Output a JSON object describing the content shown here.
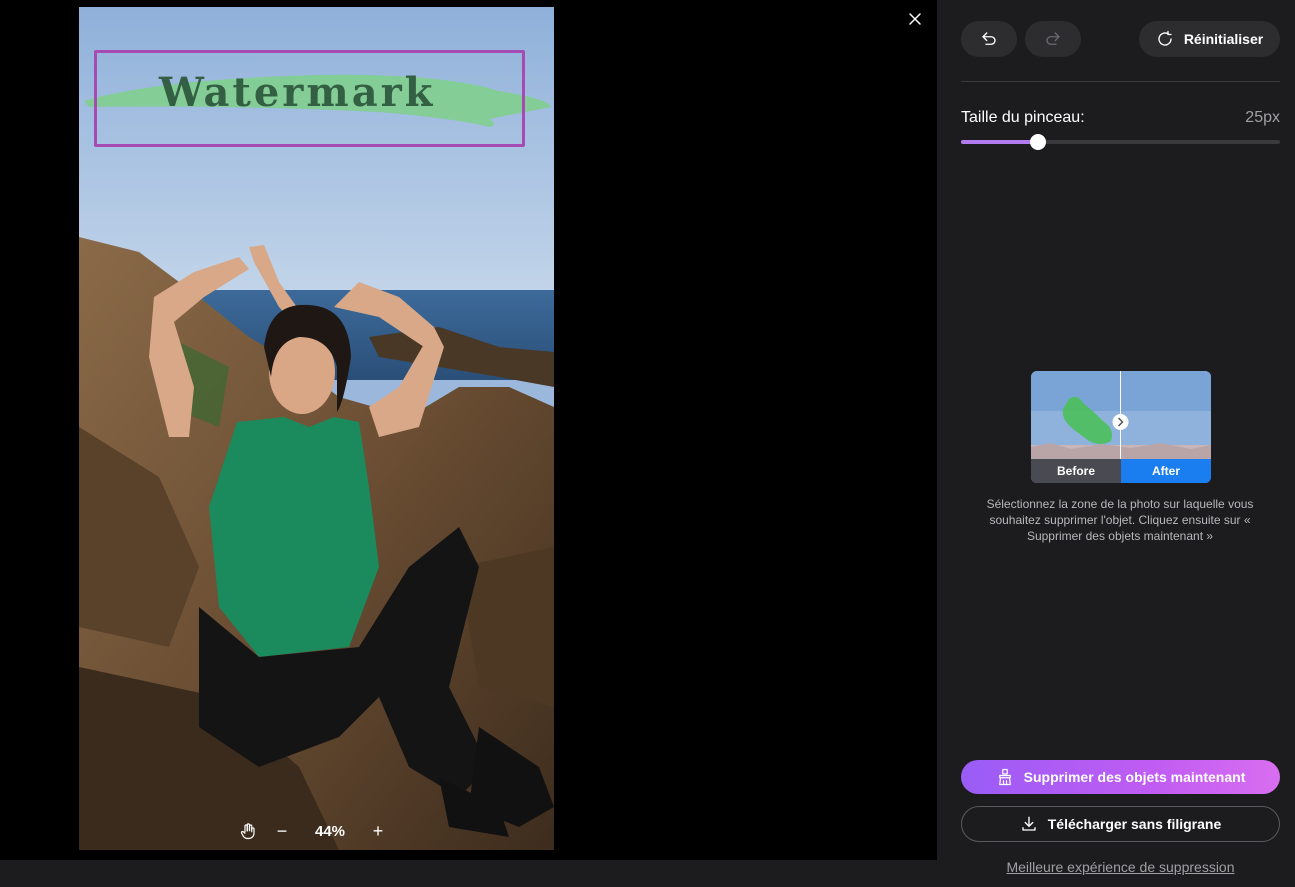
{
  "editor": {
    "watermark_text": "Watermark",
    "zoom": "44%",
    "zoom_minus": "−",
    "zoom_plus": "+"
  },
  "panel": {
    "reset_label": "Réinitialiser",
    "brush_label": "Taille du pinceau:",
    "brush_value": "25px",
    "brush_level": 0.24,
    "demo_before": "Before",
    "demo_after": "After",
    "hint": "Sélectionnez la zone de la photo sur laquelle vous souhaitez supprimer l'objet. Cliquez ensuite sur « Supprimer des objets maintenant »",
    "primary_button": "Supprimer des objets maintenant",
    "secondary_button": "Télécharger sans filigrane",
    "link": "Meilleure expérience de suppression"
  },
  "colors": {
    "accent": "#b27cf0",
    "selection": "#a74bb4",
    "after_badge": "#1a7df0"
  }
}
